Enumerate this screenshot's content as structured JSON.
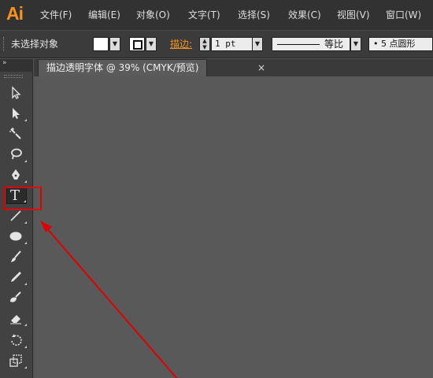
{
  "app": {
    "logo": "Ai"
  },
  "menu": {
    "file": "文件(F)",
    "edit": "编辑(E)",
    "object": "对象(O)",
    "type": "文字(T)",
    "select": "选择(S)",
    "effect": "效果(C)",
    "view": "视图(V)",
    "window": "窗口(W)"
  },
  "control": {
    "selection_status": "未选择对象",
    "stroke_label": "描边:",
    "stroke_weight": "1 pt",
    "stroke_profile": "等比",
    "brush": "• 5 点圆形"
  },
  "tools_panel": {
    "collapse_glyph": "»"
  },
  "document": {
    "tab_title": "描边透明字体 @ 39% (CMYK/预览)",
    "close_glyph": "×"
  },
  "tools": {
    "type_glyph": "T",
    "list": [
      "selection-tool",
      "direct-selection-tool",
      "magic-wand-tool",
      "lasso-tool",
      "pen-tool",
      "type-tool",
      "line-segment-tool",
      "ellipse-tool",
      "paintbrush-tool",
      "pencil-tool",
      "blob-brush-tool",
      "eraser-tool",
      "rotate-tool",
      "scale-tool"
    ],
    "active": "type-tool"
  },
  "colors": {
    "accent": "#f7941d",
    "annotation": "#e00000",
    "menubar": "#323232",
    "canvas": "#595959"
  }
}
